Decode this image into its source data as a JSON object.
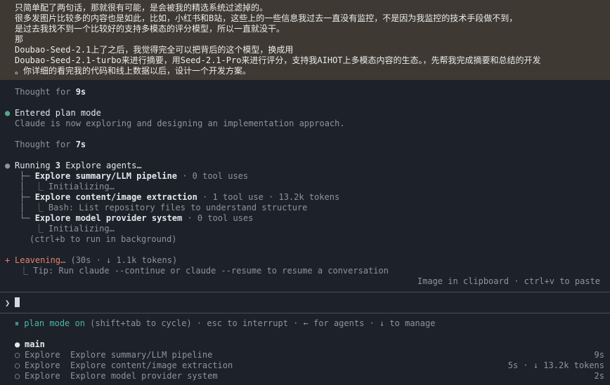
{
  "user_prompt": {
    "lines": [
      "只简单配了两句话，那就很有可能，是会被我的精选系统过滤掉的。",
      "很多发图片比较多的内容也是如此，比如，小红书和B站，这些上的一些信息我过去一直没有监控，不是因为我监控的技术手段做不到，",
      "是过去我找不到一个比较好的支持多模态的评分模型，所以一直就没干。",
      "那",
      "Doubao-Seed-2.1上了之后，我觉得完全可以把背后的这个模型，换成用",
      "Doubao-Seed-2.1-turbo来进行摘要，用Seed-2.1-Pro来进行评分，支持我AIHOT上多模态内容的生态。，先帮我完成摘要和总结的开发",
      "。你详细的看完我的代码和线上数据以后，设计一个开发方案。"
    ]
  },
  "thought1": {
    "prefix": "Thought for ",
    "value": "9s"
  },
  "plan": {
    "title": "Entered plan mode",
    "desc": "Claude is now exploring and designing an implementation approach."
  },
  "thought2": {
    "prefix": "Thought for ",
    "value": "7s"
  },
  "agents": {
    "prefix": "Running ",
    "count": "3",
    "suffix": " Explore agents…",
    "items": [
      {
        "tree": "├─ ",
        "name": "Explore summary/LLM pipeline",
        "meta": " · 0 tool uses",
        "sub_tree": "│  ⎿ ",
        "sub": "Initializing…"
      },
      {
        "tree": "├─ ",
        "name": "Explore content/image extraction",
        "meta": " · 1 tool use · 13.2k tokens",
        "sub_tree": "│  ⎿ ",
        "sub": "Bash: List repository files to understand structure"
      },
      {
        "tree": "└─ ",
        "name": "Explore model provider system",
        "meta": " · 0 tool uses",
        "sub_tree": "   ⎿ ",
        "sub": "Initializing…"
      }
    ],
    "hint": "(ctrl+b to run in background)"
  },
  "status": {
    "spinner": "+",
    "label": "Leavening…",
    "meta": " (30s · ↓ 1.1k tokens)",
    "tip_tree": "⎿ ",
    "tip": "Tip: Run claude --continue or claude --resume to resume a conversation"
  },
  "clipboard_hint": "Image in clipboard · ctrl+v to paste",
  "input": {
    "prompt_symbol": "❯",
    "value": ""
  },
  "footer": {
    "icon": "⏸",
    "mode": "plan mode on",
    "rest": " (shift+tab to cycle) · esc to interrupt · ← for agents · ↓ to manage"
  },
  "tasks": {
    "main_label": "main",
    "items": [
      {
        "kind": "Explore",
        "name": "Explore summary/LLM pipeline",
        "stat": "9s"
      },
      {
        "kind": "Explore",
        "name": "Explore content/image extraction",
        "stat": "5s · ↓ 13.2k tokens"
      },
      {
        "kind": "Explore",
        "name": "Explore model provider system",
        "stat": "2s"
      }
    ]
  },
  "colors": {
    "background": "#1d212a",
    "prompt_background": "#3e3a33",
    "accent_green": "#58a88c",
    "accent_orange": "#e3806a",
    "accent_teal": "#4fb4a6"
  }
}
